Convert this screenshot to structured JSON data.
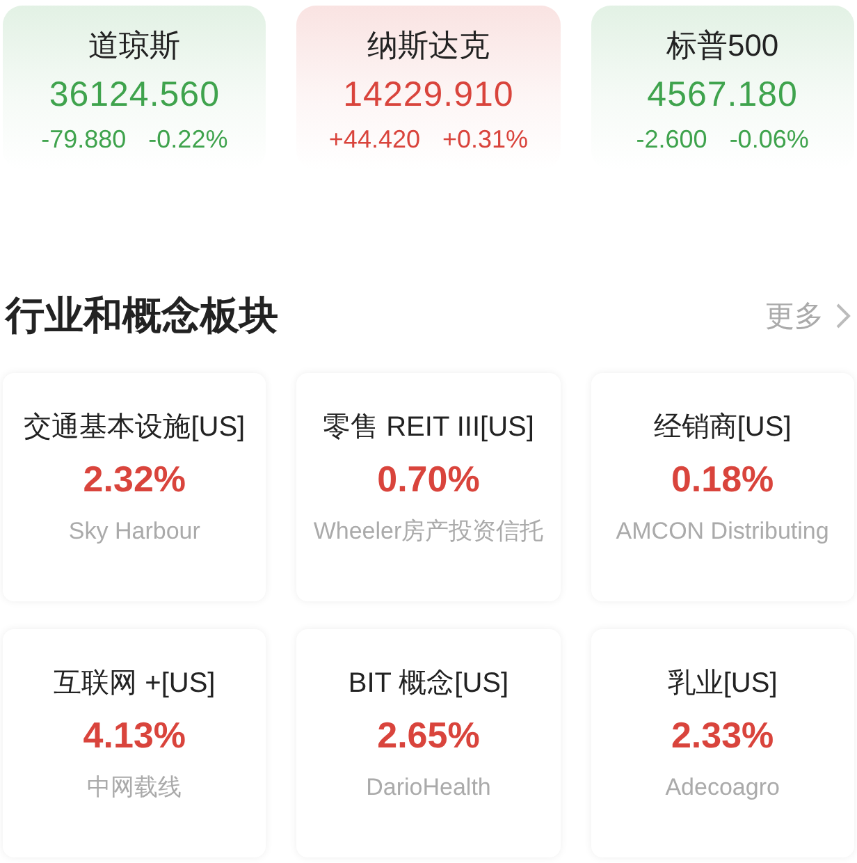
{
  "indices": [
    {
      "name": "道琼斯",
      "value": "36124.560",
      "change": "-79.880",
      "percent": "-0.22%",
      "color": "#3fa34d"
    },
    {
      "name": "纳斯达克",
      "value": "14229.910",
      "change": "+44.420",
      "percent": "+0.31%",
      "color": "#d9443c"
    },
    {
      "name": "标普500",
      "value": "4567.180",
      "change": "-2.600",
      "percent": "-0.06%",
      "color": "#3fa34d"
    }
  ],
  "section": {
    "title": "行业和概念板块",
    "more": "更多"
  },
  "sectors": [
    {
      "name": "交通基本设施[US]",
      "percent": "2.32%",
      "leader": "Sky Harbour",
      "color": "#d9443c"
    },
    {
      "name": "零售 REIT III[US]",
      "percent": "0.70%",
      "leader": "Wheeler房产投资信托",
      "color": "#d9443c"
    },
    {
      "name": "经销商[US]",
      "percent": "0.18%",
      "leader": "AMCON Distributing",
      "color": "#d9443c"
    },
    {
      "name": "互联网 +[US]",
      "percent": "4.13%",
      "leader": "中网载线",
      "color": "#d9443c"
    },
    {
      "name": "BIT 概念[US]",
      "percent": "2.65%",
      "leader": "DarioHealth",
      "color": "#d9443c"
    },
    {
      "name": "乳业[US]",
      "percent": "2.33%",
      "leader": "Adecoagro",
      "color": "#d9443c"
    }
  ]
}
